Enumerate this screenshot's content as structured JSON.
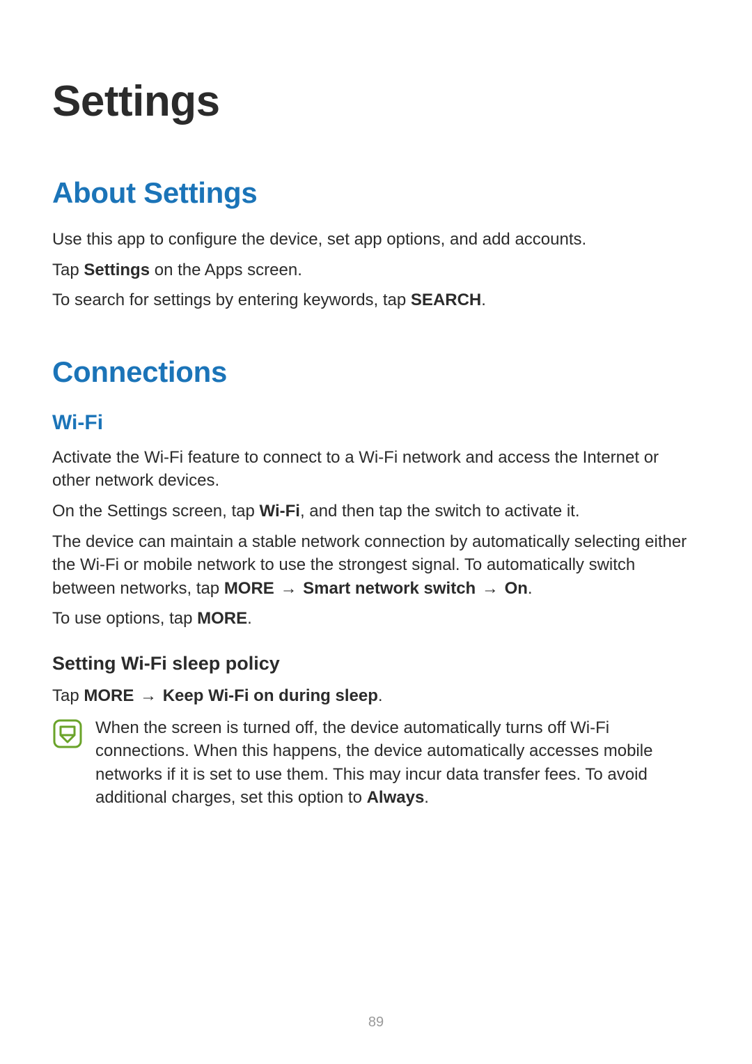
{
  "page_number": "89",
  "title": "Settings",
  "about": {
    "heading": "About Settings",
    "p1": "Use this app to configure the device, set app options, and add accounts.",
    "p2_pre": "Tap ",
    "p2_bold": "Settings",
    "p2_post": " on the Apps screen.",
    "p3_pre": "To search for settings by entering keywords, tap ",
    "p3_bold": "SEARCH",
    "p3_post": "."
  },
  "connections": {
    "heading": "Connections",
    "wifi": {
      "heading": "Wi-Fi",
      "p1": "Activate the Wi-Fi feature to connect to a Wi-Fi network and access the Internet or other network devices.",
      "p2_pre": "On the Settings screen, tap ",
      "p2_bold": "Wi-Fi",
      "p2_post": ", and then tap the switch to activate it.",
      "p3_pre": "The device can maintain a stable network connection by automatically selecting either the Wi-Fi or mobile network to use the strongest signal. To automatically switch between networks, tap ",
      "p3_b1": "MORE",
      "p3_arrow1": " → ",
      "p3_b2": "Smart network switch",
      "p3_arrow2": " → ",
      "p3_b3": "On",
      "p3_post": ".",
      "p4_pre": "To use options, tap ",
      "p4_bold": "MORE",
      "p4_post": ".",
      "sleep": {
        "heading": "Setting Wi-Fi sleep policy",
        "p1_pre": "Tap ",
        "p1_b1": "MORE",
        "p1_arrow": " → ",
        "p1_b2": "Keep Wi-Fi on during sleep",
        "p1_post": ".",
        "note_pre": "When the screen is turned off, the device automatically turns off Wi-Fi connections. When this happens, the device automatically accesses mobile networks if it is set to use them. This may incur data transfer fees. To avoid additional charges, set this option to ",
        "note_bold": "Always",
        "note_post": "."
      }
    }
  }
}
